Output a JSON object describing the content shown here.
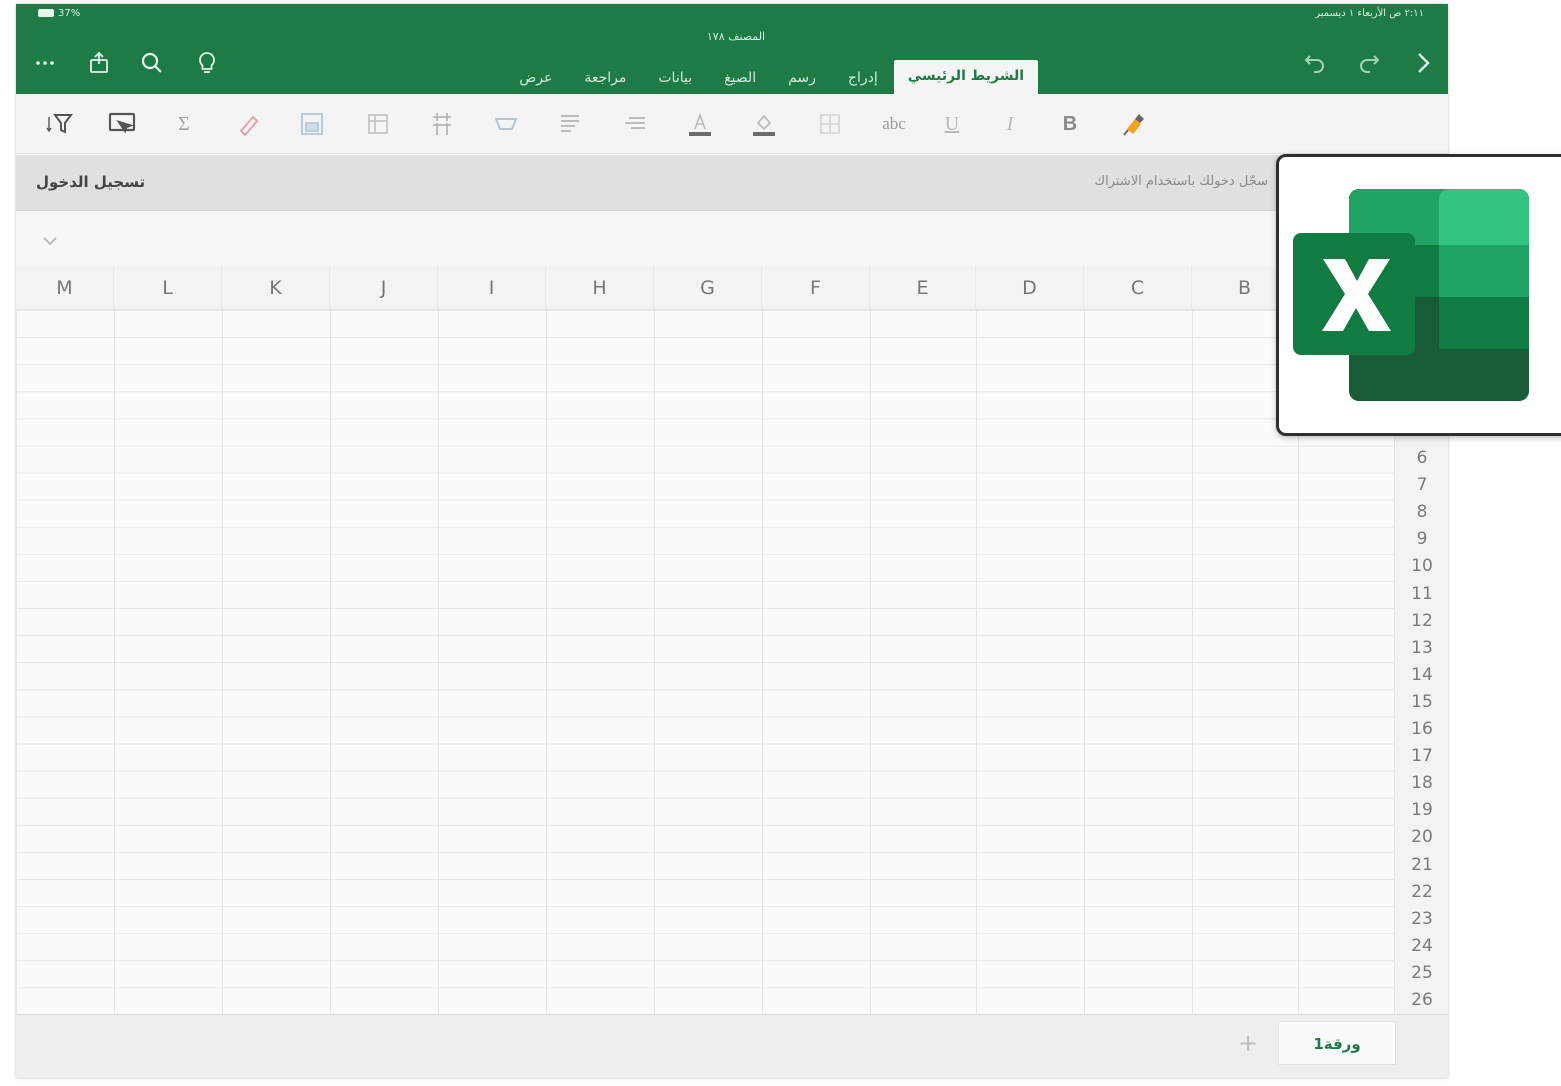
{
  "status_bar": {
    "left": "37%",
    "right": "٢:١١ ص الأربعاء ١ ديسمبر"
  },
  "title_bar": {
    "document_title": "المصنف ١٧٨",
    "tabs": [
      {
        "label": "الشريط الرئيسي",
        "active": true
      },
      {
        "label": "إدراج",
        "active": false
      },
      {
        "label": "رسم",
        "active": false
      },
      {
        "label": "الصيغ",
        "active": false
      },
      {
        "label": "بيانات",
        "active": false
      },
      {
        "label": "مراجعة",
        "active": false
      },
      {
        "label": "عرض",
        "active": false
      }
    ],
    "icons": [
      "more-icon",
      "share-icon",
      "search-icon",
      "lightbulb-icon",
      "undo-icon",
      "redo-icon",
      "forward-icon"
    ]
  },
  "ribbon": {
    "sum_glyph": "Σ",
    "abc_glyph": "abc",
    "underline_glyph": "U",
    "italic_glyph": "I",
    "bold_glyph": "B"
  },
  "message_bar": {
    "sign_in_label": "تسجيل الدخول",
    "message": "سجّل دخولك باستخدام الاشتراك"
  },
  "grid": {
    "columns": [
      "M",
      "L",
      "K",
      "J",
      "I",
      "H",
      "G",
      "F",
      "E",
      "D",
      "C",
      "B"
    ],
    "rows": [
      "6",
      "7",
      "8",
      "9",
      "10",
      "11",
      "12",
      "13",
      "14",
      "15",
      "16",
      "17",
      "18",
      "19",
      "20",
      "21",
      "22",
      "23",
      "24",
      "25",
      "26"
    ]
  },
  "sheet_bar": {
    "add_sheet_glyph": "+",
    "active_sheet": "ورقة1"
  },
  "colors": {
    "brand_green": "#1e7b45",
    "logo_dark": "#185c37",
    "logo_mid": "#21a366",
    "logo_light": "#33c481"
  }
}
